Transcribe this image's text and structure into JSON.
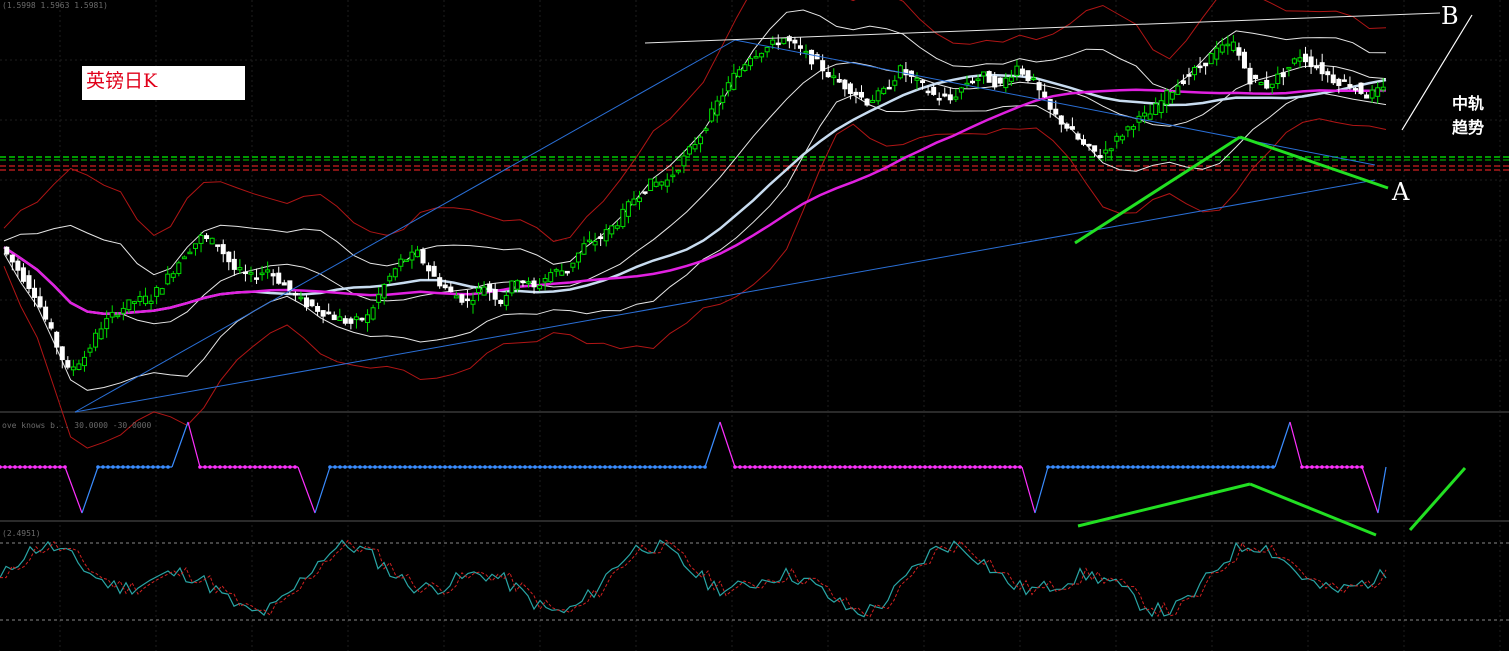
{
  "chart_title": "英镑日K",
  "annotations": {
    "label_b": "B",
    "label_a": "A",
    "mid_band_line1": "中轨",
    "mid_band_line2": "趋势"
  },
  "panel_texts": {
    "main_header": "(1.5998 1.5963 1.5981)",
    "indicator_header": "ove knows b... 30.0000 -30.0000",
    "oscillator_header": "(2.4951)"
  },
  "colors": {
    "background": "#000000",
    "bull_candle": "#00dd00",
    "bear_candle": "#ffffff",
    "ma_long": "#e020e0",
    "ma_mid": "#c8dcf0",
    "bollinger_outer": "#b01515",
    "bollinger_inner": "#e6e6e6",
    "trendline": "#2a6fd6",
    "annotation_green": "#22e022",
    "support_green": "#00cc00",
    "support_red": "#d02020",
    "osc_main": "#29a5a5",
    "osc_signal": "#d02020",
    "ind_pos": "#3a8cff",
    "ind_neg": "#ff30ff"
  },
  "chart_data": {
    "type": "candlestick",
    "title": "英镑日K",
    "close_series": [
      1.544,
      1.53,
      1.515,
      1.49,
      1.466,
      1.475,
      1.494,
      1.504,
      1.51,
      1.512,
      1.525,
      1.54,
      1.55,
      1.546,
      1.53,
      1.525,
      1.53,
      1.52,
      1.51,
      1.505,
      1.5,
      1.496,
      1.5,
      1.52,
      1.535,
      1.54,
      1.525,
      1.515,
      1.51,
      1.52,
      1.51,
      1.525,
      1.518,
      1.528,
      1.53,
      1.545,
      1.55,
      1.56,
      1.575,
      1.584,
      1.586,
      1.6,
      1.615,
      1.635,
      1.652,
      1.665,
      1.67,
      1.676,
      1.668,
      1.66,
      1.65,
      1.644,
      1.636,
      1.642,
      1.656,
      1.648,
      1.64,
      1.637,
      1.648,
      1.652,
      1.646,
      1.658,
      1.648,
      1.63,
      1.62,
      1.608,
      1.602,
      1.612,
      1.623,
      1.628,
      1.64,
      1.65,
      1.658,
      1.668,
      1.672,
      1.65,
      1.646,
      1.654,
      1.665,
      1.658,
      1.65,
      1.647,
      1.64,
      1.643
    ]
  }
}
